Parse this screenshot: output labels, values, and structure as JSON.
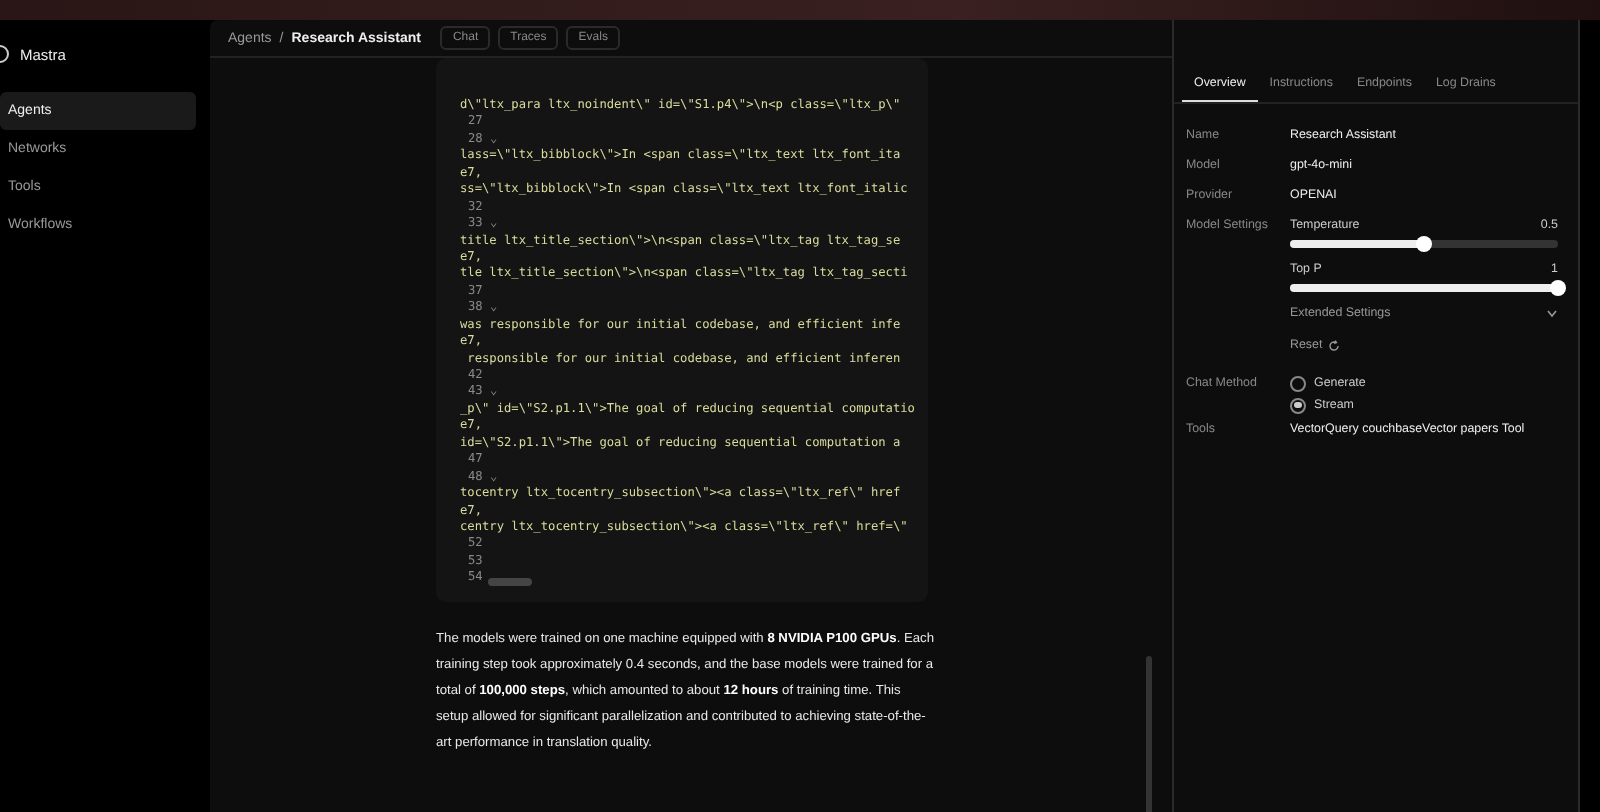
{
  "sidebar": {
    "brand": "Mastra",
    "items": [
      {
        "label": "Agents",
        "selected": true
      },
      {
        "label": "Networks",
        "selected": false
      },
      {
        "label": "Tools",
        "selected": false
      },
      {
        "label": "Workflows",
        "selected": false
      }
    ]
  },
  "breadcrumb": {
    "parent": "Agents",
    "separator": "/",
    "current": "Research Assistant"
  },
  "header_tabs": [
    {
      "label": "Chat",
      "selected": false
    },
    {
      "label": "Traces",
      "selected": false
    },
    {
      "label": "Evals",
      "selected": false
    }
  ],
  "code_lines": [
    "d\\\"ltx_para ltx_noindent\\\" id=\\\"S1.p4\\\">\\n<p class=\\\"ltx_p\\\"",
    "27",
    "28 ⌄",
    "lass=\\\"ltx_bibblock\\\">In <span class=\\\"ltx_text ltx_font_ita",
    "e7,",
    "ss=\\\"ltx_bibblock\\\">In <span class=\\\"ltx_text ltx_font_italic",
    "32",
    "33 ⌄",
    "title ltx_title_section\\\">\\n<span class=\\\"ltx_tag ltx_tag_se",
    "e7,",
    "tle ltx_title_section\\\">\\n<span class=\\\"ltx_tag ltx_tag_secti",
    "37",
    "38 ⌄",
    "was responsible for our initial codebase, and efficient infe",
    "e7,",
    " responsible for our initial codebase, and efficient inferen",
    "42",
    "43 ⌄",
    "_p\\\" id=\\\"S2.p1.1\\\">The goal of reducing sequential computatio",
    "e7,",
    "id=\\\"S2.p1.1\\\">The goal of reducing sequential computation a",
    "47",
    "48 ⌄",
    "tocentry ltx_tocentry_subsection\\\"><a class=\\\"ltx_ref\\\" href",
    "e7,",
    "centry ltx_tocentry_subsection\\\"><a class=\\\"ltx_ref\\\" href=\\\"",
    "52",
    "53",
    "54"
  ],
  "message": "The models were trained on one machine equipped with **8 NVIDIA P100 GPUs**. Each training step took approximately 0.4 seconds, and the base models were trained for a total of **100,000 steps**, which amounted to about **12 hours** of training time. This setup allowed for significant parallelization and contributed to achieving state-of-the-art performance in translation quality.",
  "panel_tabs": [
    {
      "label": "Overview",
      "selected": true
    },
    {
      "label": "Instructions",
      "selected": false
    },
    {
      "label": "Endpoints",
      "selected": false
    },
    {
      "label": "Log Drains",
      "selected": false
    }
  ],
  "overview": {
    "name": {
      "label": "Name",
      "value": "Research Assistant"
    },
    "model": {
      "label": "Model",
      "value": "gpt-4o-mini"
    },
    "provider": {
      "label": "Provider",
      "value": "OPENAI"
    },
    "model_settings": {
      "label": "Model Settings",
      "sliders": [
        {
          "name": "Temperature",
          "reading": "0.5",
          "level": 0.5
        },
        {
          "name": "Top P",
          "reading": "1",
          "level": 1
        }
      ],
      "extended_settings": "Extended Settings",
      "expanded": false,
      "reset": "Reset"
    },
    "chat_method": {
      "label": "Chat Method",
      "options": [
        {
          "label": "Generate",
          "selected": false
        },
        {
          "label": "Stream",
          "selected": true
        }
      ]
    },
    "tools": {
      "label": "Tools",
      "value": "VectorQuery couchbaseVector papers Tool"
    }
  }
}
